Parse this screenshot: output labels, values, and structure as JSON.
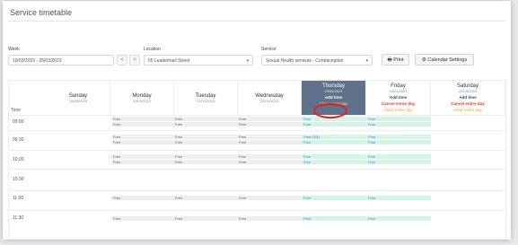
{
  "title": "Service timetable",
  "filters": {
    "week_label": "Week",
    "week_value": "19/03/2023 - 25/03/2023",
    "prev": "<",
    "next": ">",
    "location_label": "Location",
    "location_value": "65 Leadermall Street",
    "service_label": "Service",
    "service_value": "Sexual Health services - Contraception"
  },
  "buttons": {
    "print": "Print",
    "calendar_settings": "Calendar Settings"
  },
  "time_header": "Time",
  "days": [
    {
      "name": "Sunday",
      "date": "19/03/2023"
    },
    {
      "name": "Monday",
      "date": "20/03/2023"
    },
    {
      "name": "Tuesday",
      "date": "21/03/2023"
    },
    {
      "name": "Wednesday",
      "date": "22/03/2023"
    },
    {
      "name": "Thursday",
      "date": "23/03/2023",
      "add_time": "Add time",
      "clear": "Clear entire day"
    },
    {
      "name": "Friday",
      "date": "24/03/2023",
      "add_time": "Add time",
      "cancel": "Cancel entire day",
      "clear": "Clear entire day"
    },
    {
      "name": "Saturday",
      "date": "25/03/2023",
      "add_time": "Add time",
      "cancel": "Cancel entire day",
      "clear": "Clear entire day"
    }
  ],
  "times": [
    "09:00",
    "09:30",
    "10:00",
    "10:30",
    "11:00",
    "11:30"
  ],
  "slots": {
    "free": "Free",
    "free_count": "Free (3/3)"
  },
  "colors": {
    "thursday_header": "#60728a",
    "free_past": "#eeeeee",
    "free_bookable": "#d7f2e7",
    "cancel": "#e03b2a",
    "clear": "#f2a01d",
    "highlight_ring": "#e31b23"
  }
}
